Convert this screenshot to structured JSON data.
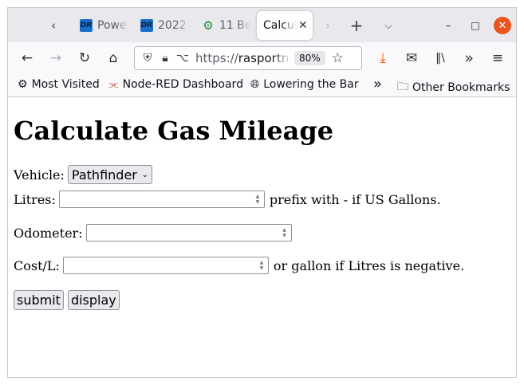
{
  "tabs": [
    {
      "label": "Power",
      "icon": "dr-favicon"
    },
    {
      "label": "2022",
      "icon": "dr-favicon"
    },
    {
      "label": "11 Be",
      "icon": "gear-favicon"
    },
    {
      "label": "Calculate",
      "icon": "none",
      "active": true
    }
  ],
  "favicon_text": "DR",
  "url": {
    "scheme": "https://",
    "host": "rasportne"
  },
  "zoom": "80%",
  "bookmarks": [
    {
      "label": "Most Visited",
      "icon": "gear-icon"
    },
    {
      "label": "Node-RED Dashboard",
      "icon": "node-red-icon"
    },
    {
      "label": "Lowering the Bar",
      "icon": "globe-icon"
    },
    {
      "label": "Other Bookmarks",
      "icon": "folder-icon"
    }
  ],
  "page": {
    "title": "Calculate Gas Mileage",
    "vehicle_label": "Vehicle:",
    "vehicle_value": "Pathfinder",
    "litres_label": "Litres:",
    "litres_note": "prefix with - if US Gallons.",
    "odometer_label": "Odometer:",
    "cost_label": "Cost/L:",
    "cost_note": "or gallon if Litres is negative.",
    "submit_label": "submit",
    "display_label": "display"
  },
  "colors": {
    "window_close": "#e95420",
    "download_icon": "#e8581a"
  }
}
